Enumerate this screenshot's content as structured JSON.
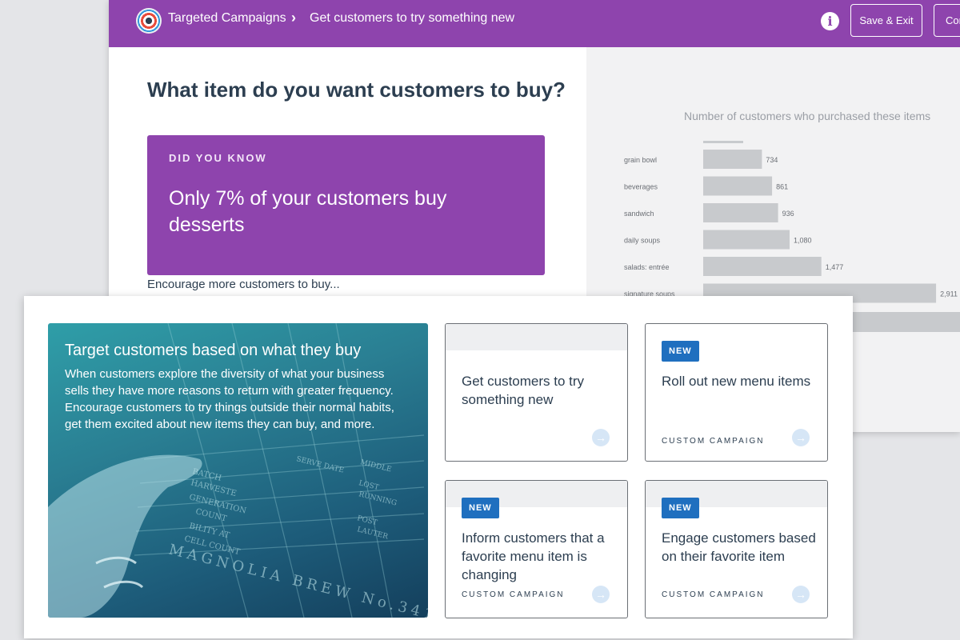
{
  "header": {
    "breadcrumb_1": "Targeted Campaigns",
    "breadcrumb_sep": "›",
    "breadcrumb_2": "Get customers to try something new",
    "info_icon": "i",
    "save_exit_label": "Save & Exit",
    "continue_label": "Continue"
  },
  "main": {
    "question": "What item do you want customers to buy?",
    "did_you_know_label": "DID YOU KNOW",
    "did_you_know_text": "Only 7% of your customers buy desserts",
    "encourage_text": "Encourage more customers to buy..."
  },
  "chart_data": {
    "type": "bar",
    "title": "Number of customers who purchased these items",
    "categories": [
      "grain bowl",
      "beverages",
      "sandwich",
      "daily soups",
      "salads: entrée",
      "signature soups"
    ],
    "values": [
      734,
      861,
      936,
      1080,
      1477,
      2911
    ],
    "value_labels": [
      "734",
      "861",
      "936",
      "1,080",
      "1,477",
      "2,911"
    ],
    "orientation": "horizontal",
    "bar_color": "#c8cacd",
    "xlim": [
      0,
      3000
    ]
  },
  "hero": {
    "title": "Target customers based on what they buy",
    "text": "When customers explore the diversity of what your business sells they have more reasons to return with greater frequency. Encourage customers to try things outside their normal habits, get them excited about new items they can buy, and more."
  },
  "cards": [
    {
      "title": "Get customers to try something new",
      "badge": "",
      "subtitle": ""
    },
    {
      "title": "Roll out new menu items",
      "badge": "NEW",
      "subtitle": "CUSTOM CAMPAIGN"
    },
    {
      "title": "Inform customers that a favorite menu item is changing",
      "badge": "NEW",
      "subtitle": "CUSTOM CAMPAIGN"
    },
    {
      "title": "Engage customers based on their favorite item",
      "badge": "NEW",
      "subtitle": "CUSTOM CAMPAIGN"
    }
  ],
  "icons": {
    "arrow": "arrow-right-circle-icon",
    "logo": "target-icon",
    "info": "info-icon"
  },
  "colors": {
    "brand_purple": "#8e44ad",
    "badge_blue": "#1f6fbf",
    "text_dark": "#2c3e50"
  }
}
